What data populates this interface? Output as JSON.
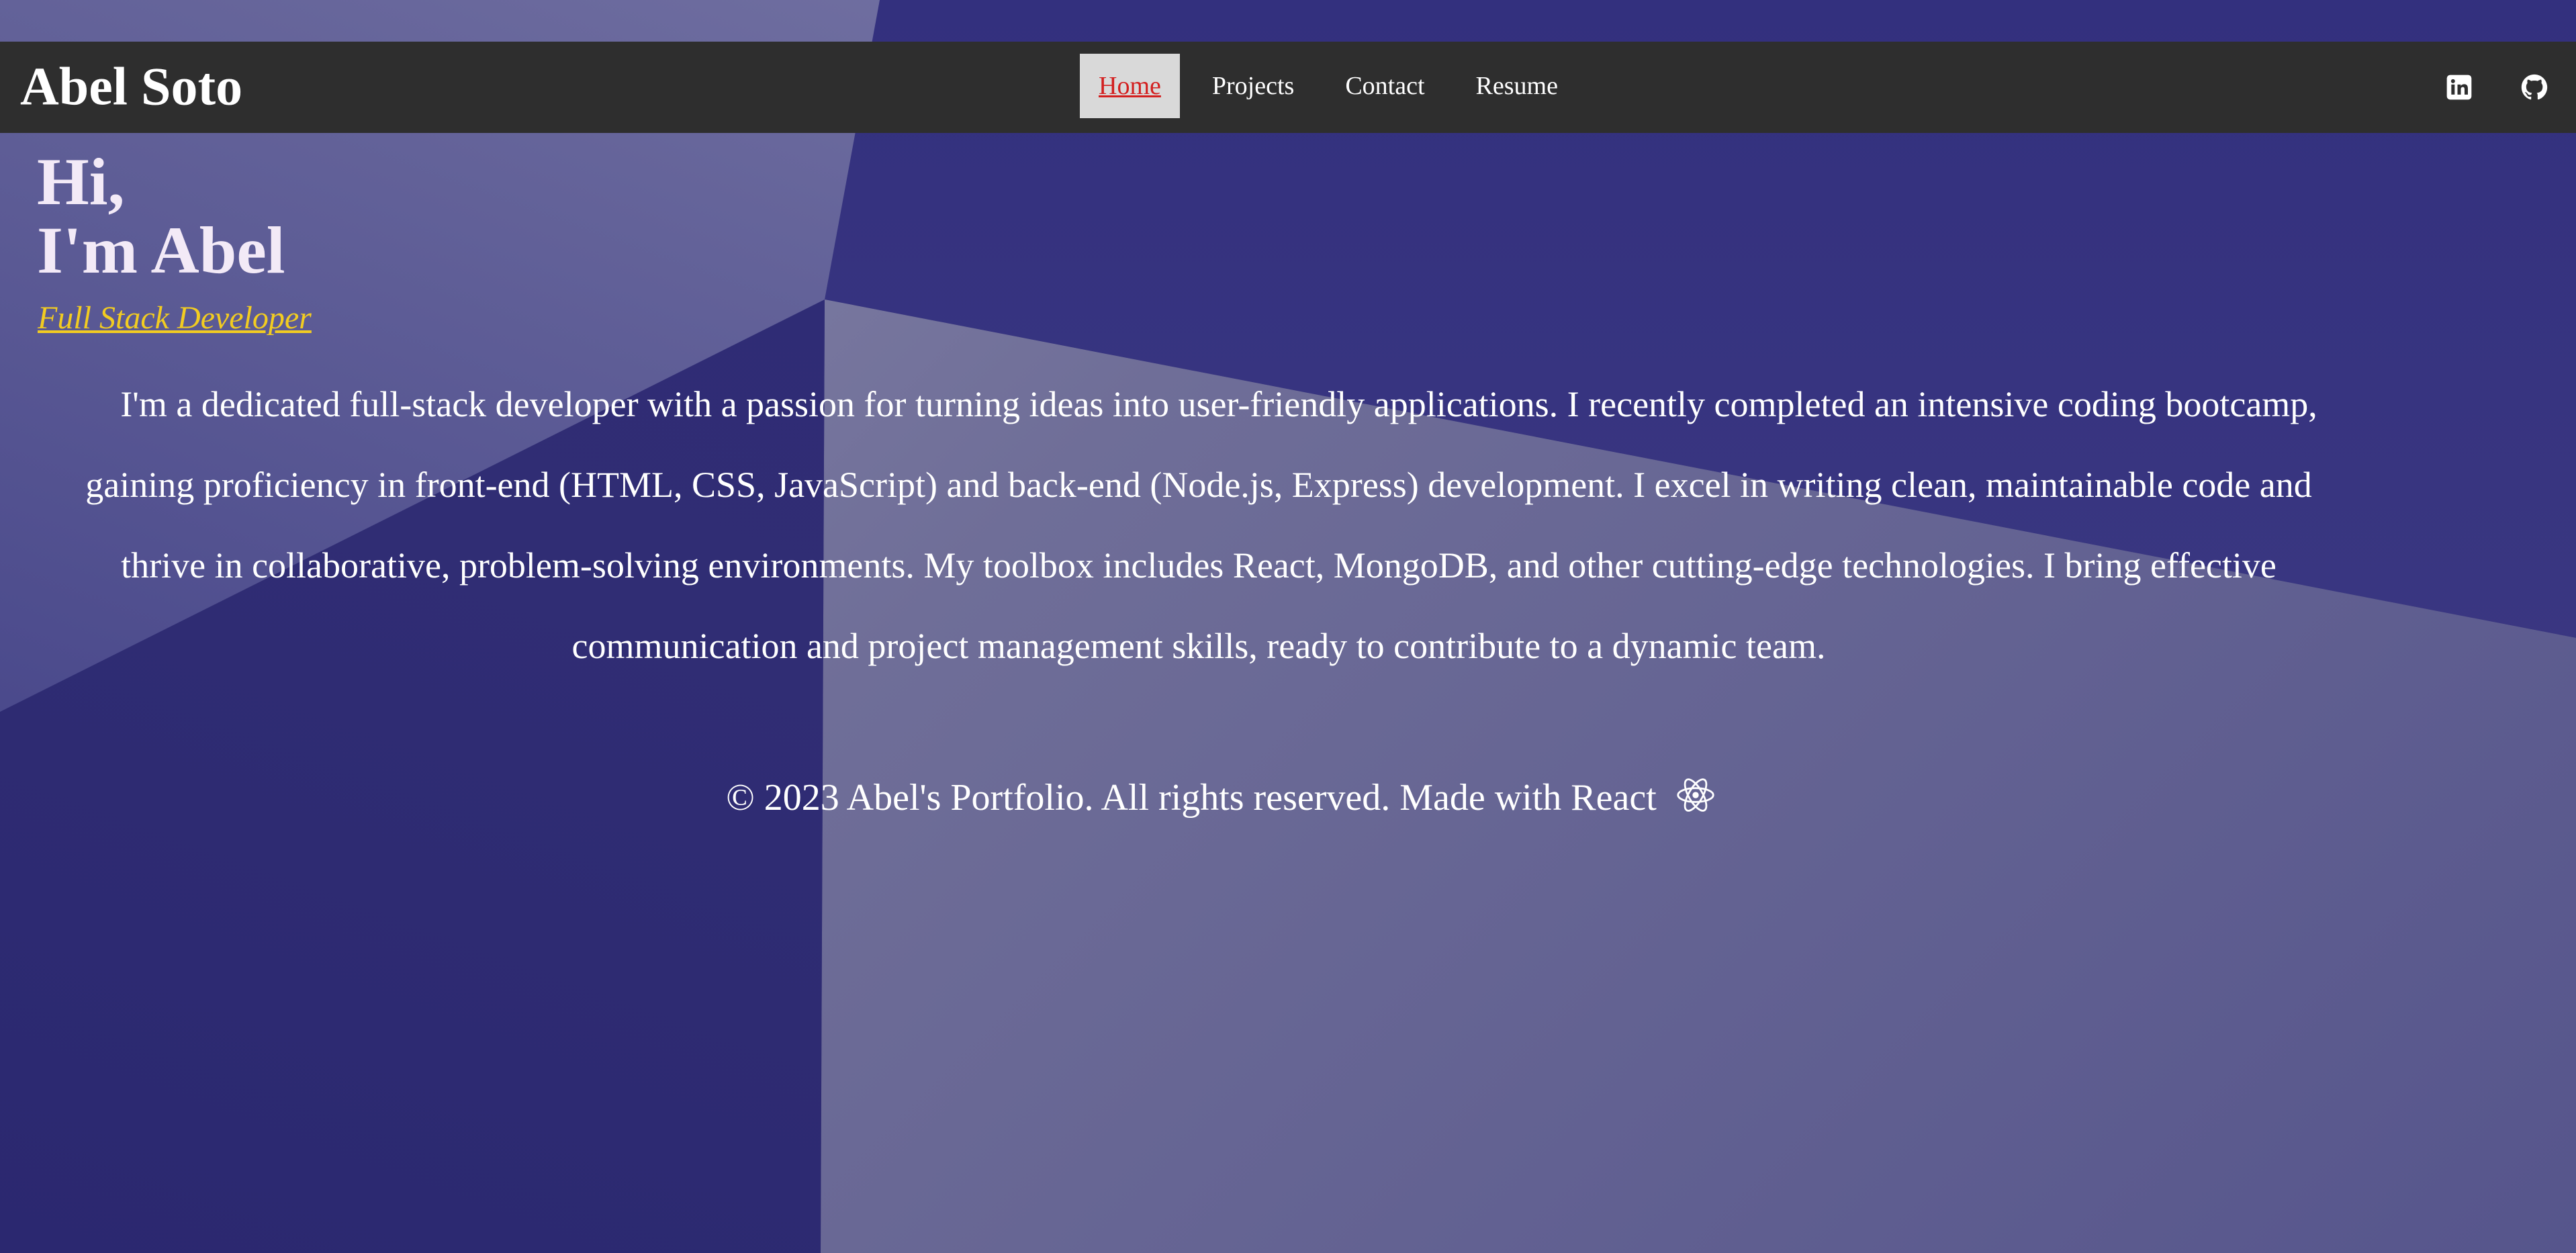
{
  "navbar": {
    "brand": "Abel Soto",
    "links": [
      {
        "label": "Home",
        "active": true
      },
      {
        "label": "Projects",
        "active": false
      },
      {
        "label": "Contact",
        "active": false
      },
      {
        "label": "Resume",
        "active": false
      }
    ],
    "social": [
      {
        "icon": "linkedin-icon"
      },
      {
        "icon": "github-icon"
      }
    ]
  },
  "hero": {
    "greeting_line1": "Hi,",
    "greeting_line2": "I'm Abel",
    "role": "Full Stack Developer",
    "bio": "I'm a dedicated full-stack developer with a passion for turning ideas into user-friendly applications. I recently completed an intensive coding bootcamp, gaining proficiency in front-end (HTML, CSS, JavaScript) and back-end (Node.js, Express) development. I excel in writing clean, maintainable code and thrive in collaborative, problem-solving environments. My toolbox includes React, MongoDB, and other cutting-edge technologies. I bring effective communication and project management skills, ready to contribute to a dynamic team."
  },
  "footer": {
    "text": "© 2023 Abel's Portfolio. All rights reserved. Made with React",
    "icon": "react-icon"
  },
  "colors": {
    "navbar_bg": "#2e2e2e",
    "active_link_bg": "#d9d9d9",
    "active_link_text": "#d31f1f",
    "role_text": "#f2cc21",
    "greeting_text": "#f3eaf7"
  }
}
